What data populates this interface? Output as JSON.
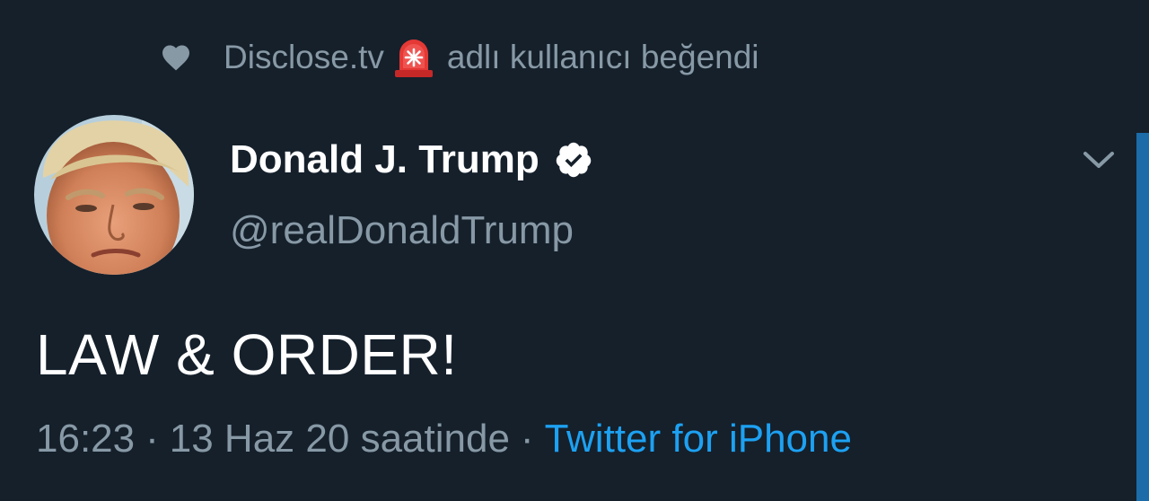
{
  "social_context": {
    "icon": "heart-icon",
    "liker_name": "Disclose.tv",
    "liker_emoji": "siren-icon",
    "action_text": "adlı kullanıcı beğendi"
  },
  "tweet": {
    "display_name": "Donald J. Trump",
    "verified": true,
    "username": "@realDonaldTrump",
    "text": "LAW & ORDER!",
    "time": "16:23",
    "separator": "·",
    "date": "13 Haz 20 saatinde",
    "source": "Twitter for iPhone"
  },
  "colors": {
    "background": "#15202b",
    "secondary_text": "#8899a6",
    "primary_text": "#ffffff",
    "link": "#1da1f2"
  }
}
